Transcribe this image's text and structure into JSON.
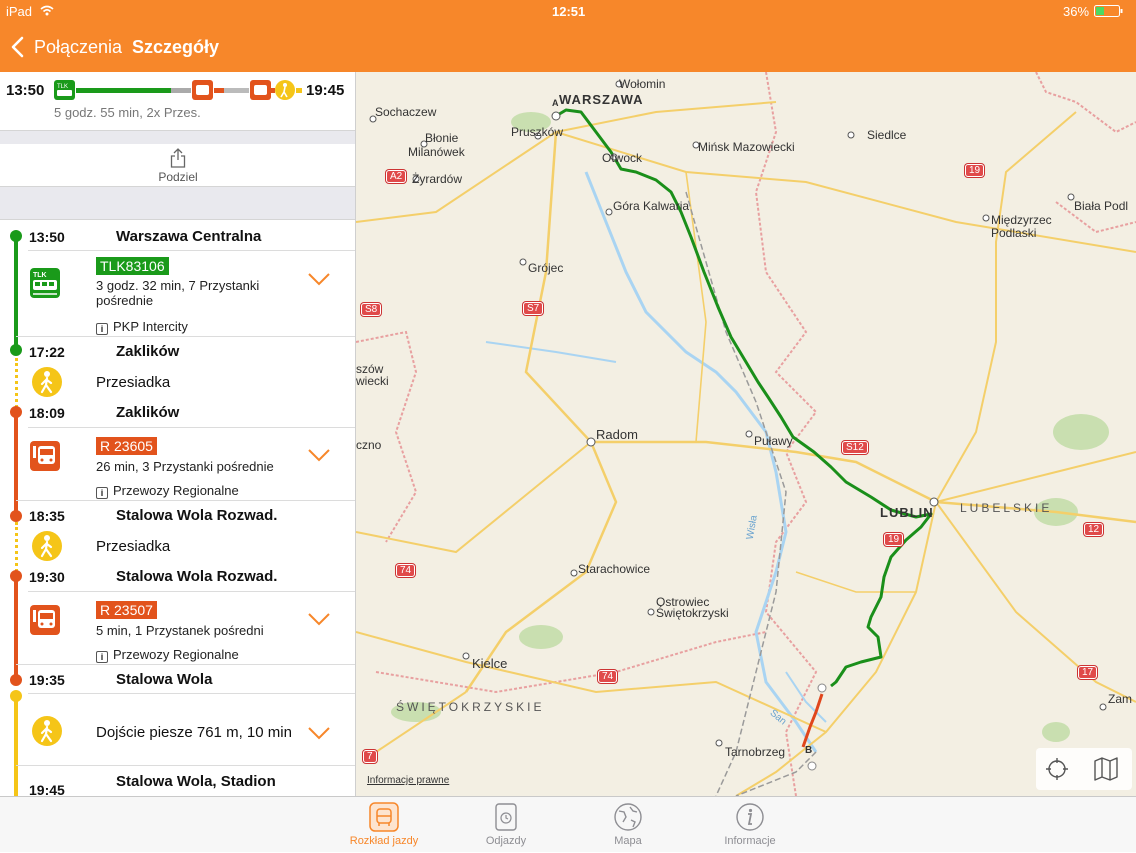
{
  "status_bar": {
    "device": "iPad",
    "time": "12:51",
    "battery": "36%"
  },
  "nav": {
    "back_label": "Połączenia",
    "title": "Szczegóły"
  },
  "summary": {
    "depart": "13:50",
    "arrive": "19:45",
    "duration": "5 godz. 55 min, 2x Przes."
  },
  "share": {
    "label": "Podziel"
  },
  "itinerary": {
    "s1": {
      "time": "13:50",
      "name": "Warszawa Centralna"
    },
    "leg1": {
      "train": "TLK83106",
      "detail": "3 godz. 32 min, 7 Przystanki pośrednie",
      "operator": "PKP Intercity",
      "color": "#1a9a1a"
    },
    "s2": {
      "time": "17:22",
      "name": "Zaklików"
    },
    "walk1": {
      "label": "Przesiadka"
    },
    "s3": {
      "time": "18:09",
      "name": "Zaklików"
    },
    "leg2": {
      "train": "R 23605",
      "detail": "26 min, 3 Przystanki pośrednie",
      "operator": "Przewozy Regionalne",
      "color": "#e2531c"
    },
    "s4": {
      "time": "18:35",
      "name": "Stalowa Wola Rozwad."
    },
    "walk2": {
      "label": "Przesiadka"
    },
    "s5": {
      "time": "19:30",
      "name": "Stalowa Wola Rozwad."
    },
    "leg3": {
      "train": "R 23507",
      "detail": "5 min, 1 Przystanek pośredni",
      "operator": "Przewozy Regionalne",
      "color": "#e2531c"
    },
    "s6": {
      "time": "19:35",
      "name": "Stalowa Wola"
    },
    "walk3": {
      "label": "Dojście piesze 761 m, 10 min"
    },
    "s7": {
      "time": "19:45",
      "name": "Stalowa Wola, Stadion"
    }
  },
  "map": {
    "legal": "Informacje prawne",
    "labels": {
      "warszawa": "WARSZAWA",
      "wolomin": "Wołomin",
      "sochaczew": "Sochaczew",
      "pruszkow": "Pruszków",
      "blonie": "Błonie",
      "milanowek": "Milanówek",
      "otwock": "Otwock",
      "siedlce": "Siedlce",
      "minsk": "Mińsk Mazowiecki",
      "zyrardow": "Żyrardów",
      "gora": "Góra Kalwaria",
      "biala": "Biała Podl",
      "miedzyrzec1": "Międzyrzec",
      "miedzyrzec2": "Podlaski",
      "grojec": "Grójec",
      "szow": "szów",
      "wiecki": "wiecki",
      "radom": "Radom",
      "pulawy": "Puławy",
      "czno": "czno",
      "lublin": "LUBLIN",
      "lubelskie": "LUBELSKIE",
      "starachowice": "Starachowice",
      "ostrowiec1": "Ostrowiec",
      "ostrowiec2": "Świętokrzyski",
      "kielce": "Kielce",
      "swietokrzyskie": "ŚWIĘTOKRZYSKIE",
      "tarnobrzeg": "Tarnobrzeg",
      "zam": "Zam",
      "wisla": "Wisła",
      "san": "San",
      "a": "A",
      "b": "B"
    },
    "roads": {
      "a2": "A2",
      "s8": "S8",
      "s7": "S7",
      "s12": "S12",
      "r19a": "19",
      "r19b": "19",
      "r12": "12",
      "r74a": "74",
      "r74b": "74",
      "r17": "17",
      "r7": "7"
    }
  },
  "tabs": [
    {
      "label": "Rozkład jazdy",
      "icon": "bus-icon",
      "active": true
    },
    {
      "label": "Odjazdy",
      "icon": "clock-icon",
      "active": false
    },
    {
      "label": "Mapa",
      "icon": "globe-icon",
      "active": false
    },
    {
      "label": "Informacje",
      "icon": "info-icon",
      "active": false
    }
  ],
  "colors": {
    "accent": "#f7872a",
    "tlk": "#1a9a1a",
    "regio": "#e2531c",
    "walk": "#f5c518"
  }
}
